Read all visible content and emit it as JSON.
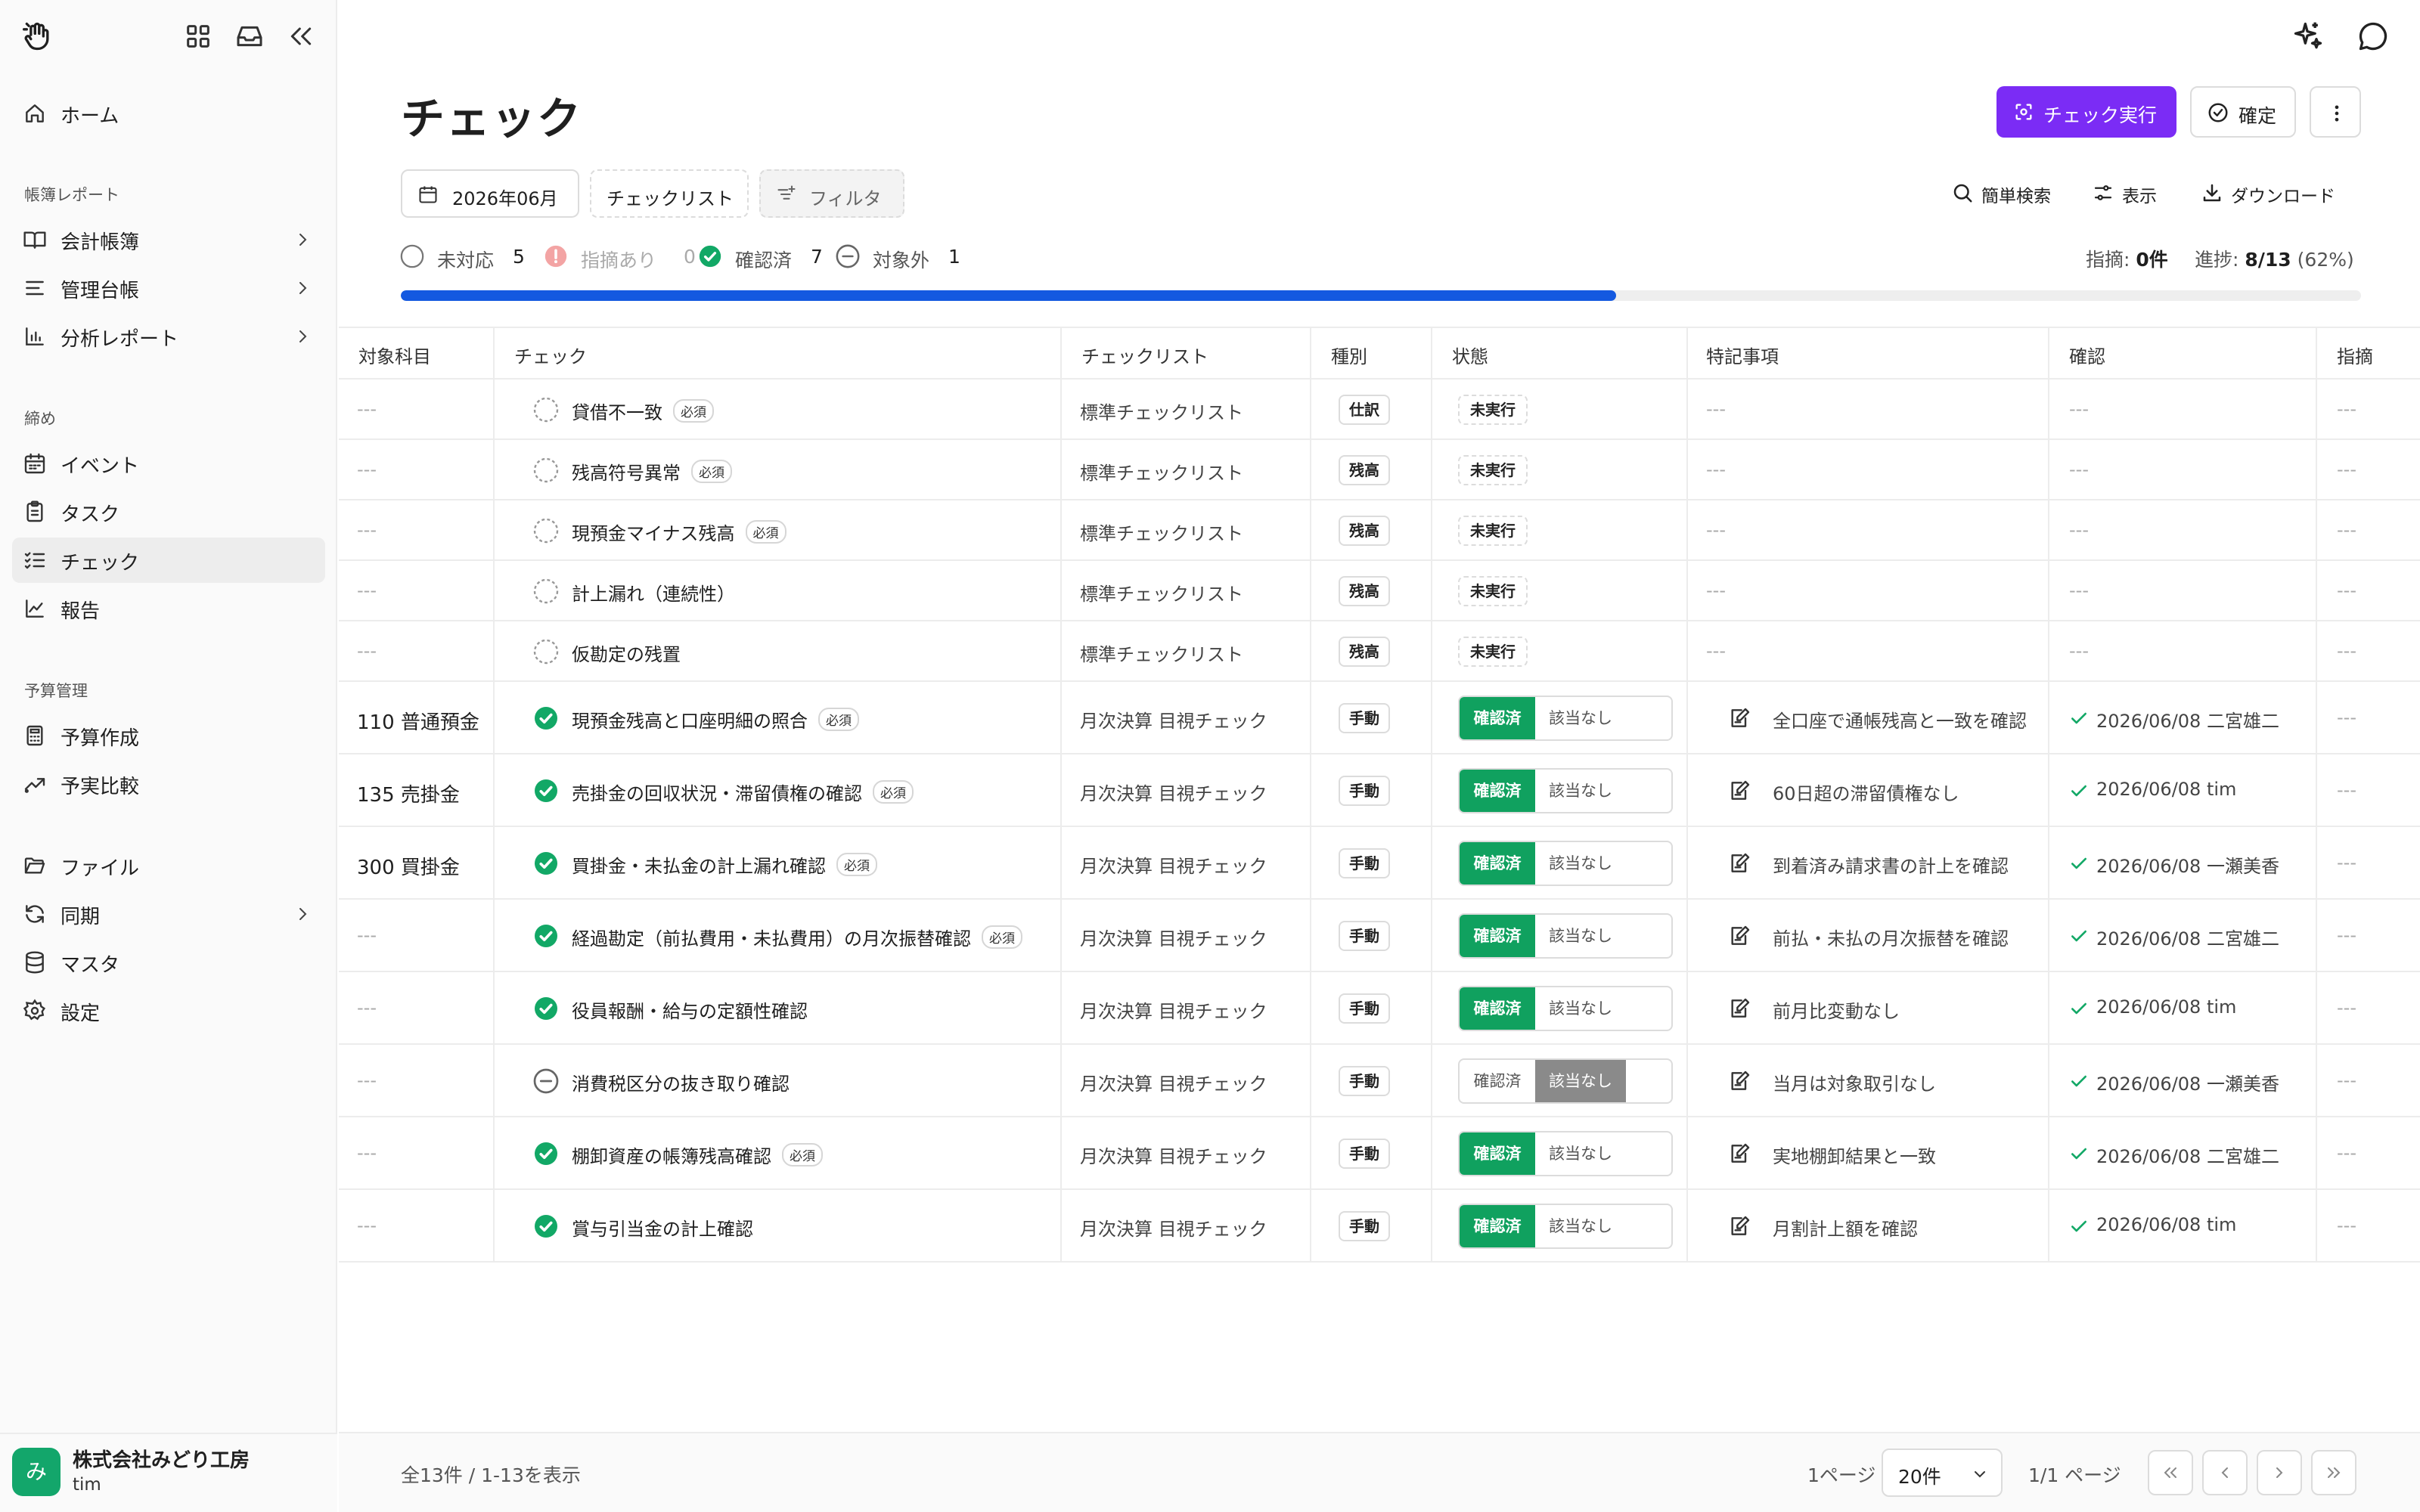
{
  "sidebar": {
    "org_name": "株式会社みどり工房",
    "user": "tim",
    "avatar_text": "み",
    "home": "ホーム",
    "sections": {
      "ledger": "帳簿レポート",
      "closing": "締め",
      "budget": "予算管理"
    },
    "items": {
      "accounting_book": "会計帳簿",
      "management_ledger": "管理台帳",
      "analysis_report": "分析レポート",
      "event": "イベント",
      "task": "タスク",
      "check": "チェック",
      "report": "報告",
      "budget_create": "予算作成",
      "budget_compare": "予実比較",
      "file": "ファイル",
      "sync": "同期",
      "master": "マスタ",
      "settings": "設定"
    }
  },
  "header": {
    "title": "チェック",
    "run_button": "チェック実行",
    "confirm_button": "確定",
    "accent_color": "#7b2cf5"
  },
  "filters": {
    "period": "2026年06月",
    "checklist": "チェックリスト",
    "filter": "フィルタ"
  },
  "tools": {
    "search": "簡単検索",
    "display": "表示",
    "download": "ダウンロード"
  },
  "stats": {
    "unhandled_label": "未対応",
    "unhandled_count": "5",
    "flagged_label": "指摘あり",
    "flagged_count": "0",
    "confirmed_label": "確認済",
    "confirmed_count": "7",
    "excluded_label": "対象外",
    "excluded_count": "1"
  },
  "summary": {
    "findings_label": "指摘: ",
    "findings_value": "0件",
    "progress_label": "進捗: ",
    "progress_value": "8/13",
    "progress_pct": "(62%)",
    "progress_fraction": 0.62
  },
  "table": {
    "headers": {
      "account": "対象科目",
      "check": "チェック",
      "checklist": "チェックリスト",
      "type": "種別",
      "state": "状態",
      "notes": "特記事項",
      "confirm": "確認",
      "finding": "指摘"
    },
    "required_label": "必須",
    "confirmed_label": "確認済",
    "na_label": "該当なし",
    "rows": [
      {
        "account": "---",
        "check": "貸借不一致",
        "required": true,
        "status": "pending",
        "checklist": "標準チェックリスト",
        "type": "仕訳",
        "state": "未実行",
        "note": "---",
        "confirm": "---",
        "finding": "---"
      },
      {
        "account": "---",
        "check": "残高符号異常",
        "required": true,
        "status": "pending",
        "checklist": "標準チェックリスト",
        "type": "残高",
        "state": "未実行",
        "note": "---",
        "confirm": "---",
        "finding": "---"
      },
      {
        "account": "---",
        "check": "現預金マイナス残高",
        "required": true,
        "status": "pending",
        "checklist": "標準チェックリスト",
        "type": "残高",
        "state": "未実行",
        "note": "---",
        "confirm": "---",
        "finding": "---"
      },
      {
        "account": "---",
        "check": "計上漏れ（連続性）",
        "required": false,
        "status": "pending",
        "checklist": "標準チェックリスト",
        "type": "残高",
        "state": "未実行",
        "note": "---",
        "confirm": "---",
        "finding": "---"
      },
      {
        "account": "---",
        "check": "仮勘定の残置",
        "required": false,
        "status": "pending",
        "checklist": "標準チェックリスト",
        "type": "残高",
        "state": "未実行",
        "note": "---",
        "confirm": "---",
        "finding": "---"
      },
      {
        "account": "110 普通預金",
        "check": "現預金残高と口座明細の照合",
        "required": true,
        "status": "done",
        "checklist": "月次決算 目視チェック",
        "type": "手動",
        "state": "confirmed",
        "note": "全口座で通帳残高と一致を確認",
        "confirm": "2026/06/08 二宮雄二",
        "finding": "---"
      },
      {
        "account": "135 売掛金",
        "check": "売掛金の回収状況・滞留債権の確認",
        "required": true,
        "status": "done",
        "checklist": "月次決算 目視チェック",
        "type": "手動",
        "state": "confirmed",
        "note": "60日超の滞留債権なし",
        "confirm": "2026/06/08 tim",
        "finding": "---"
      },
      {
        "account": "300 買掛金",
        "check": "買掛金・未払金の計上漏れ確認",
        "required": true,
        "status": "done",
        "checklist": "月次決算 目視チェック",
        "type": "手動",
        "state": "confirmed",
        "note": "到着済み請求書の計上を確認",
        "confirm": "2026/06/08 一瀬美香",
        "finding": "---"
      },
      {
        "account": "---",
        "check": "経過勘定（前払費用・未払費用）の月次振替確認",
        "required": true,
        "status": "done",
        "checklist": "月次決算 目視チェック",
        "type": "手動",
        "state": "confirmed",
        "note": "前払・未払の月次振替を確認",
        "confirm": "2026/06/08 二宮雄二",
        "finding": "---"
      },
      {
        "account": "---",
        "check": "役員報酬・給与の定額性確認",
        "required": false,
        "status": "done",
        "checklist": "月次決算 目視チェック",
        "type": "手動",
        "state": "confirmed",
        "note": "前月比変動なし",
        "confirm": "2026/06/08 tim",
        "finding": "---"
      },
      {
        "account": "---",
        "check": "消費税区分の抜き取り確認",
        "required": false,
        "status": "na",
        "checklist": "月次決算 目視チェック",
        "type": "手動",
        "state": "na",
        "note": "当月は対象取引なし",
        "confirm": "2026/06/08 一瀬美香",
        "finding": "---"
      },
      {
        "account": "---",
        "check": "棚卸資産の帳簿残高確認",
        "required": true,
        "status": "done",
        "checklist": "月次決算 目視チェック",
        "type": "手動",
        "state": "confirmed",
        "note": "実地棚卸結果と一致",
        "confirm": "2026/06/08 二宮雄二",
        "finding": "---"
      },
      {
        "account": "---",
        "check": "賞与引当金の計上確認",
        "required": false,
        "status": "done",
        "checklist": "月次決算 目視チェック",
        "type": "手動",
        "state": "confirmed",
        "note": "月割計上額を確認",
        "confirm": "2026/06/08 tim",
        "finding": "---"
      }
    ]
  },
  "pagination": {
    "total": "全13件 / 1-13を表示",
    "page": "1ページ",
    "per_page": "20件",
    "pages": "1/1 ページ"
  }
}
